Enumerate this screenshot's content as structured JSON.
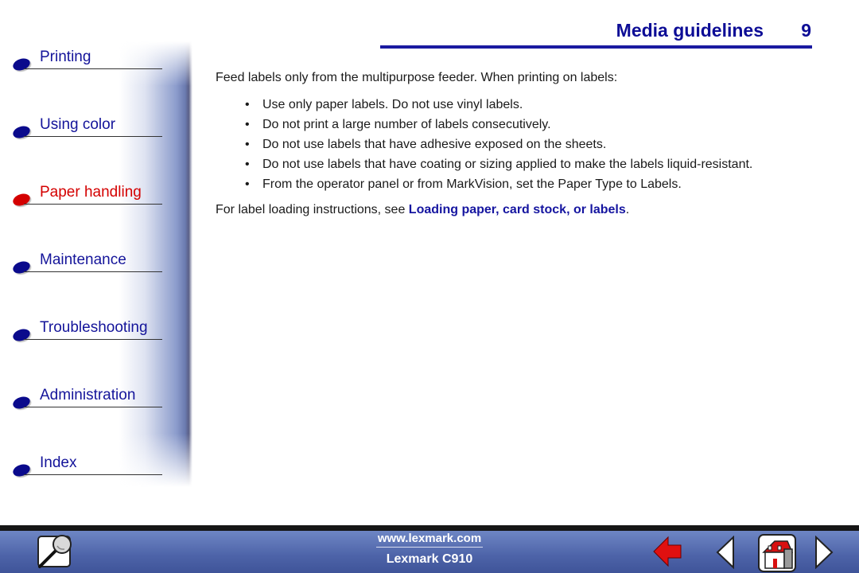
{
  "header": {
    "title": "Media guidelines",
    "page_number": "9"
  },
  "sidebar": {
    "items": [
      {
        "label": "Printing",
        "active": false
      },
      {
        "label": "Using color",
        "active": false
      },
      {
        "label": "Paper handling",
        "active": true
      },
      {
        "label": "Maintenance",
        "active": false
      },
      {
        "label": "Troubleshooting",
        "active": false
      },
      {
        "label": "Administration",
        "active": false
      },
      {
        "label": "Index",
        "active": false
      }
    ]
  },
  "content": {
    "intro": "Feed labels only from the multipurpose feeder. When printing on labels:",
    "bullet_char": "•",
    "bullets": [
      "Use only paper labels. Do not use vinyl labels.",
      "Do not print a large number of labels consecutively.",
      "Do not use labels that have adhesive exposed on the sheets.",
      "Do not use labels that have coating or sizing applied to make the labels liquid-resistant.",
      "From the operator panel or from MarkVision, set the Paper Type to Labels."
    ],
    "outro_prefix": "For label loading instructions, see ",
    "outro_link": "Loading paper, card stock, or labels",
    "outro_suffix": "."
  },
  "footer": {
    "website": "www.lexmark.com",
    "model": "Lexmark C910",
    "icons": [
      "search-icon",
      "back-arrow-icon",
      "previous-page-icon",
      "home-icon",
      "next-page-icon"
    ]
  },
  "colors": {
    "nav_blue": "#14149a",
    "active_red": "#d40000",
    "heading_blue": "#0d0d96",
    "footer_blue": "#4d63a8"
  }
}
